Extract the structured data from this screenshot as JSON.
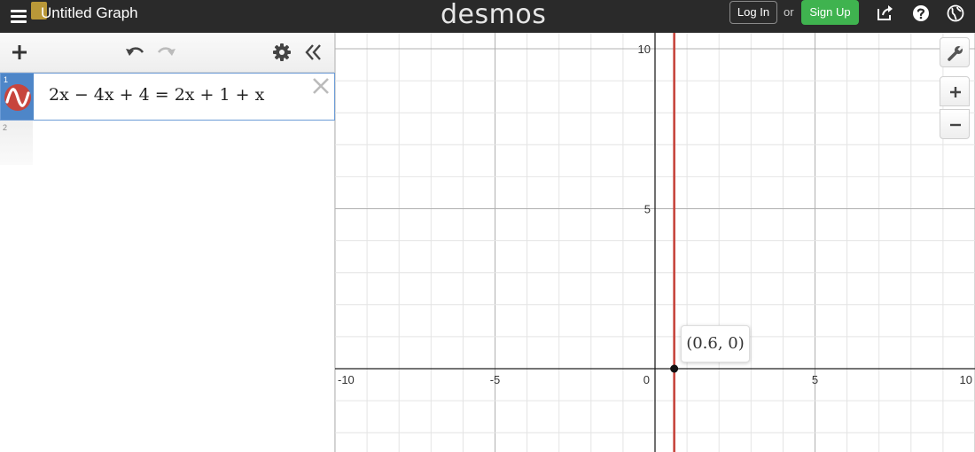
{
  "header": {
    "title": "Untitled Graph",
    "logo": "desmos",
    "login_label": "Log In",
    "or_label": "or",
    "signup_label": "Sign Up",
    "icons": [
      "menu-icon",
      "share-icon",
      "help-icon",
      "globe-icon"
    ]
  },
  "toolbar": {
    "icons": [
      "add-icon",
      "undo-icon",
      "redo-icon",
      "settings-icon",
      "collapse-icon"
    ]
  },
  "expressions": [
    {
      "index": "1",
      "latex": "2x − 4x + 4 = 2x + 1 + x",
      "color": "#c7453d"
    },
    {
      "index": "2",
      "latex": ""
    }
  ],
  "graph": {
    "x_ticks": [
      "-10",
      "-5",
      "0",
      "5",
      "10"
    ],
    "y_ticks": [
      "10",
      "5"
    ],
    "point": {
      "x": 0.6,
      "y": 0,
      "label": "(0.6, 0)"
    },
    "line_color": "#c7453d"
  },
  "controls": {
    "icons": [
      "wrench-icon",
      "zoom-in-icon",
      "zoom-out-icon"
    ]
  }
}
